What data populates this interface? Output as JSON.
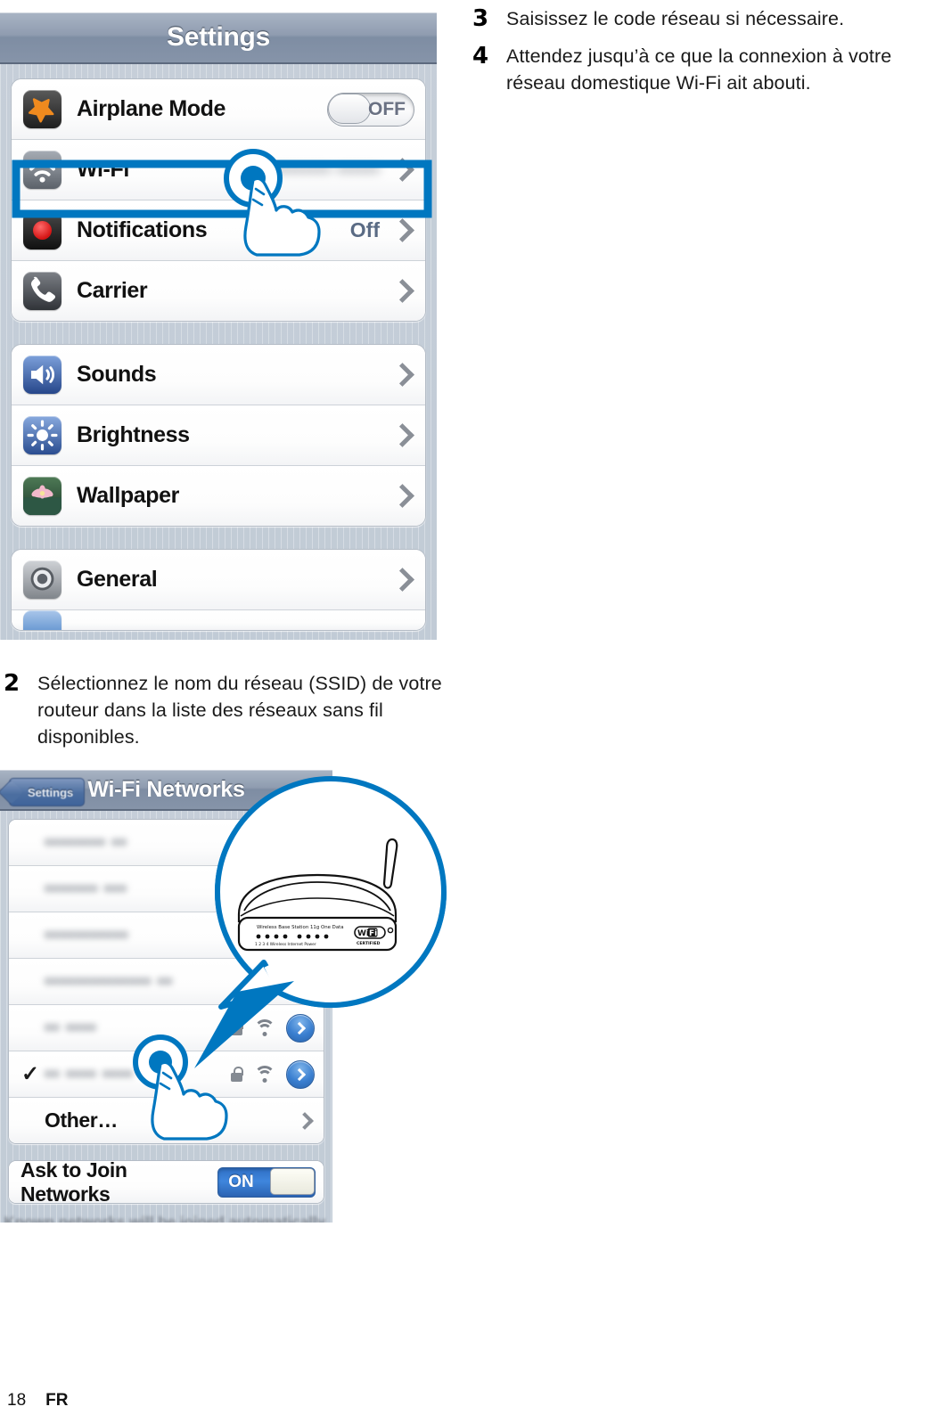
{
  "page": {
    "number": "18",
    "language": "FR"
  },
  "steps": [
    {
      "number": "2",
      "text": "Sélectionnez le nom du réseau (SSID) de votre routeur dans la liste des réseaux sans fil disponibles."
    },
    {
      "number": "3",
      "text": "Saisissez le code réseau si nécessaire."
    },
    {
      "number": "4",
      "text": "Attendez jusqu’à ce que la connexion à votre réseau domestique Wi-Fi ait abouti."
    }
  ],
  "settings_screen": {
    "navbar_title": "Settings",
    "groups": [
      {
        "rows": [
          {
            "label": "Airplane Mode",
            "icon": "airplane-icon",
            "icon_colors": [
              "#4a4a4a",
              "#1b1b1b"
            ],
            "control": "switch",
            "switch_state": "OFF",
            "highlighted": false
          },
          {
            "label": "Wi-Fi",
            "icon": "wifi-icon",
            "icon_colors": [
              "#9aa0a8",
              "#5e646c"
            ],
            "value": "•••••••• ••••••",
            "value_redacted": true,
            "control": "chevron",
            "highlighted": true
          },
          {
            "label": "Notifications",
            "icon": "notifications-icon",
            "icon_colors": [
              "#3a3a3a",
              "#111111"
            ],
            "value": "Off",
            "control": "chevron",
            "highlighted": false
          },
          {
            "label": "Carrier",
            "icon": "carrier-phone-icon",
            "icon_colors": [
              "#6f7378",
              "#3a3d41"
            ],
            "control": "chevron",
            "highlighted": false
          }
        ]
      },
      {
        "rows": [
          {
            "label": "Sounds",
            "icon": "speaker-icon",
            "icon_colors": [
              "#5f87c7",
              "#2b4f8f"
            ],
            "control": "chevron",
            "highlighted": false
          },
          {
            "label": "Brightness",
            "icon": "brightness-sun-icon",
            "icon_colors": [
              "#6f93d0",
              "#2d5193"
            ],
            "control": "chevron",
            "highlighted": false
          },
          {
            "label": "Wallpaper",
            "icon": "wallpaper-flower-icon",
            "icon_colors": [
              "#4d6b4a",
              "#223b2a"
            ],
            "control": "chevron",
            "highlighted": false
          }
        ]
      },
      {
        "rows": [
          {
            "label": "General",
            "icon": "gear-icon",
            "icon_colors": [
              "#b9bcc0",
              "#7d8287"
            ],
            "control": "chevron",
            "highlighted": false
          }
        ]
      }
    ]
  },
  "wifi_screen": {
    "navbar_title": "Wi-Fi Networks",
    "back_button_label": "Settings",
    "networks": [
      {
        "name": "•••••••• ••",
        "redacted": true,
        "checked": false,
        "locked": false,
        "signal": false,
        "detail": false
      },
      {
        "name": "••••••• •••",
        "redacted": true,
        "checked": false,
        "locked": false,
        "signal": false,
        "detail": false
      },
      {
        "name": "•••••••••••",
        "redacted": true,
        "checked": false,
        "locked": false,
        "signal": false,
        "detail": false
      },
      {
        "name": "•••••••••••••• ••",
        "redacted": true,
        "checked": false,
        "locked": false,
        "signal": false,
        "detail": false
      },
      {
        "name": "•• ••••",
        "redacted": true,
        "checked": false,
        "locked": true,
        "signal": true,
        "detail": true
      },
      {
        "name": "•• •••• ••••",
        "redacted": true,
        "checked": true,
        "locked": true,
        "signal": true,
        "detail": true
      }
    ],
    "other_row_label": "Other…",
    "ask_to_join": {
      "label": "Ask to Join Networks",
      "state": "ON"
    },
    "footer_note": "Known networks will be joined automatically.  If no known networks are"
  },
  "callout": {
    "device_label": "Wireless Base Station 11g One Data",
    "device_sub_label": "Wireless Base Station 11g One",
    "certification_badge": "Wi-Fi CERTIFIED"
  },
  "colors": {
    "accent_blue": "#0077c0",
    "ios_bg": "#c6cfd9",
    "navbar": "#8f9cb0"
  }
}
